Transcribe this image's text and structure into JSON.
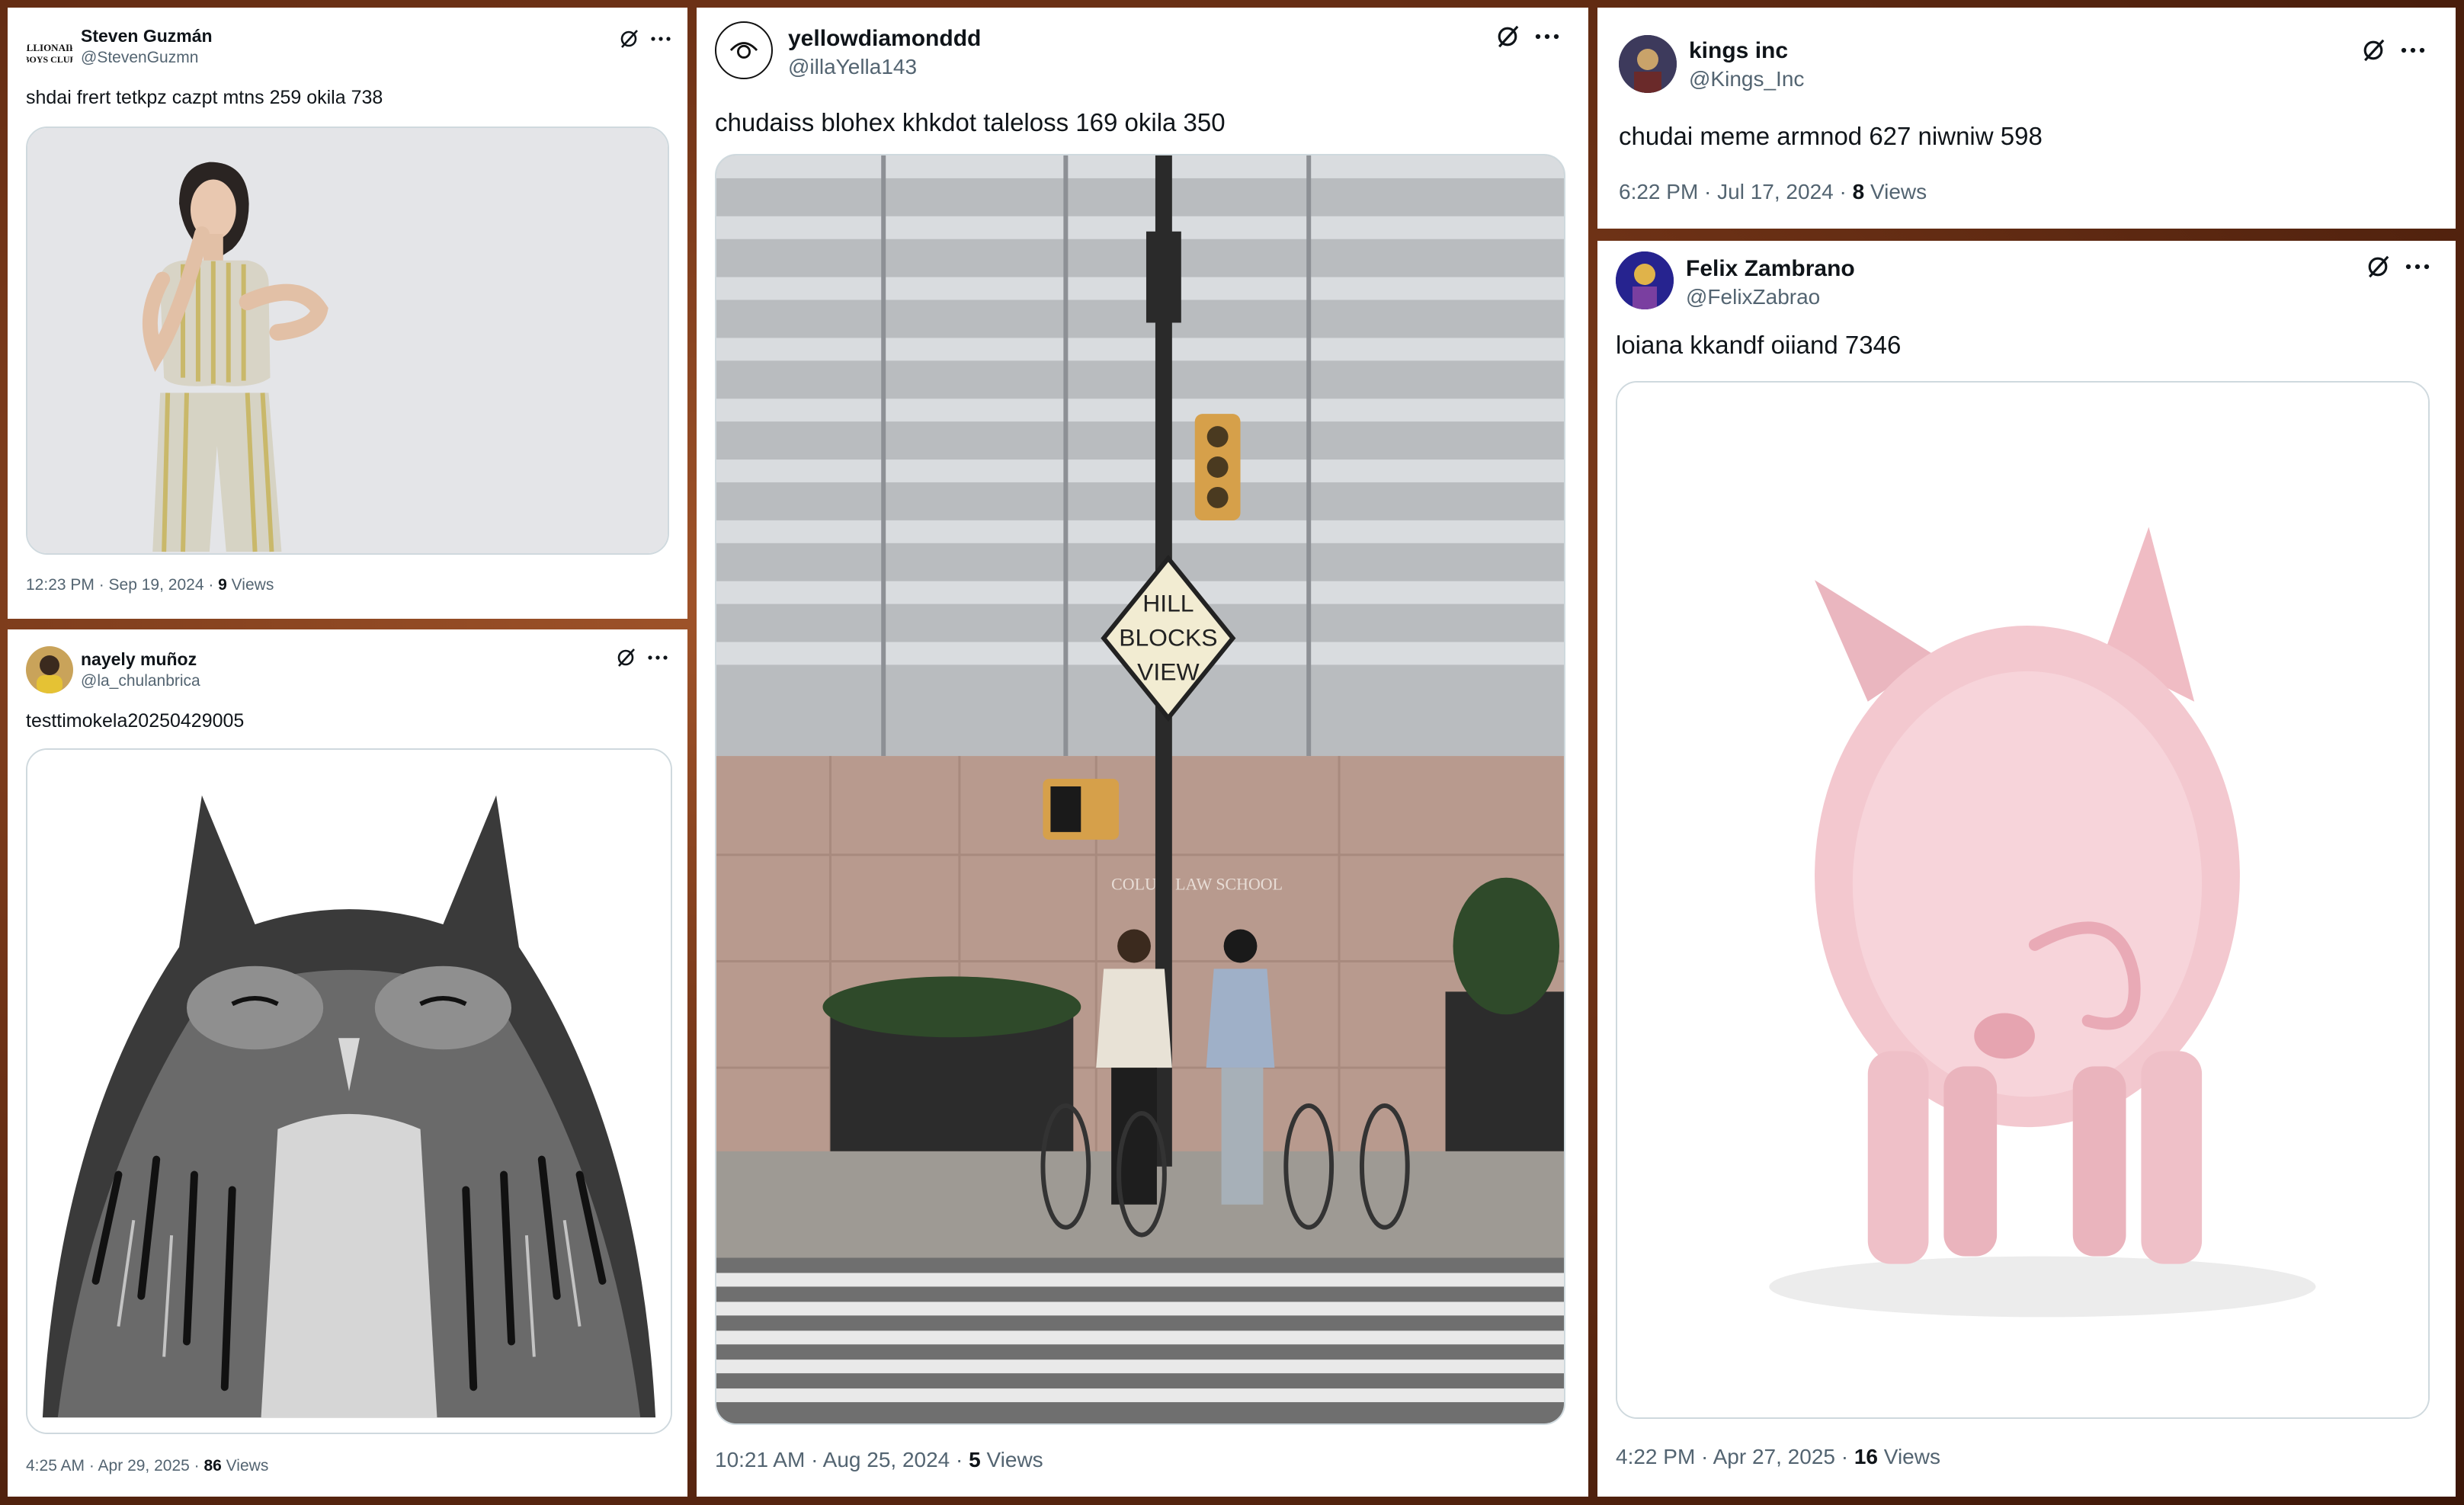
{
  "posts": [
    {
      "name": "Steven Guzmán",
      "handle": "@StevenGuzmn",
      "text": "shdai frert tetkpz cazpt mtns 259 okila 738",
      "time": "12:23 PM · Sep 19, 2024 · ",
      "views_count": "9",
      "views_label": " Views",
      "avatar_text": "BILLIONAIRE BOYS CLUB",
      "image": "woman-posing-photo"
    },
    {
      "name": "nayely muñoz",
      "handle": "@la_chulanbrica",
      "text": "testtimokela20250429005",
      "time": "4:25 AM · Apr 29, 2025 · ",
      "views_count": "86",
      "views_label": " Views",
      "image": "owl-illustration"
    },
    {
      "name": "yellowdiamonddd",
      "handle": "@illaYella143",
      "text": "chudaiss blohex khkdot taleloss 169 okila 350",
      "time": "10:21 AM · Aug 25, 2024 · ",
      "views_count": "5",
      "views_label": " Views",
      "image": "street-crossing-photo",
      "sign_lines": [
        "HILL",
        "BLOCKS",
        "VIEW"
      ],
      "building_text": "COLU    A LAW SCHOOL"
    },
    {
      "name": "kings inc",
      "handle": "@Kings_Inc",
      "text": "chudai meme armnod 627 niwniw 598",
      "time": "6:22 PM · Jul 17, 2024 · ",
      "views_count": "8",
      "views_label": " Views"
    },
    {
      "name": "Felix Zambrano",
      "handle": "@FelixZabrao",
      "text": "loiana kkandf oiiand 7346",
      "time": "4:22 PM · Apr 27, 2025 · ",
      "views_count": "16",
      "views_label": " Views",
      "image": "pig-photo"
    }
  ],
  "icons": {
    "grok": "grok-icon",
    "more": "more-icon"
  },
  "colors": {
    "background": "#6e3216",
    "card": "#ffffff",
    "secondary_text": "#536471",
    "border": "#cfd9de"
  }
}
